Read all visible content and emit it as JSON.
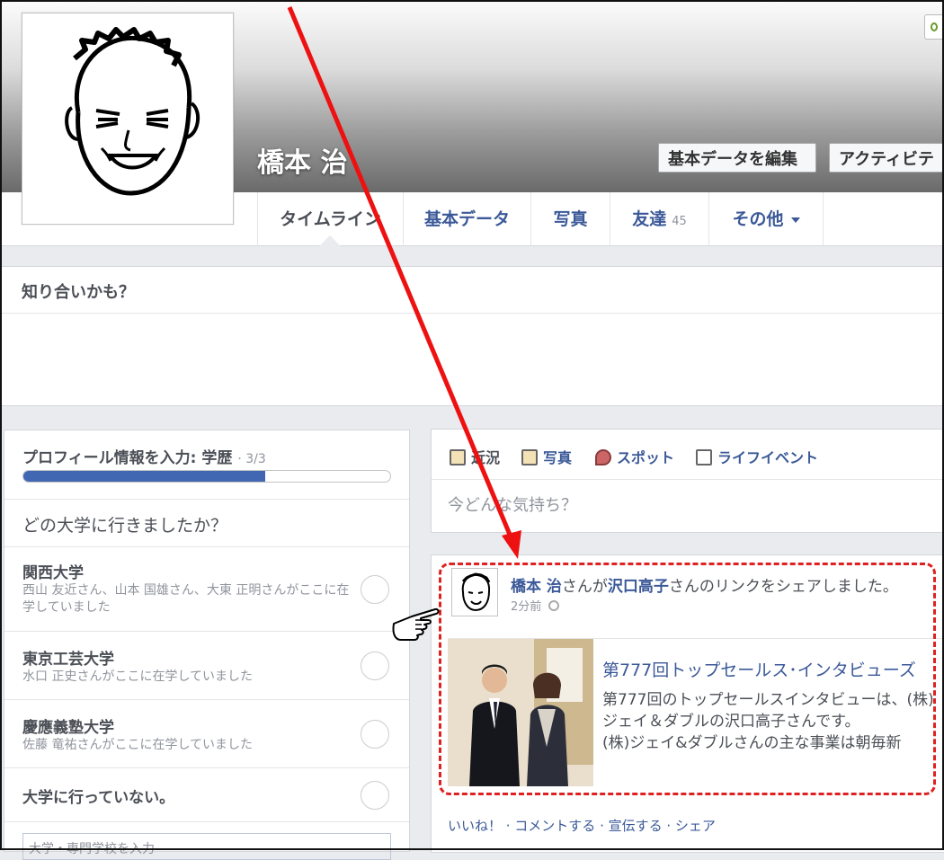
{
  "profile": {
    "name": "橋本 治",
    "edit_button": "基本データを編集",
    "activity_button": "アクティビテ"
  },
  "tabs": [
    {
      "label": "タイムライン",
      "active": true
    },
    {
      "label": "基本データ"
    },
    {
      "label": "写真"
    },
    {
      "label": "友達",
      "count": "45"
    },
    {
      "label": "その他"
    }
  ],
  "pymk": {
    "title": "知り合いかも？"
  },
  "profile_info": {
    "title": "プロフィール情報を入力: 学歴",
    "progress_text": "· 3/3",
    "progress_fraction": 0.66,
    "question": "どの大学に行きましたか？",
    "schools": [
      {
        "name": "関西大学",
        "desc": "西山 友近さん、山本 国雄さん、大東 正明さんがここに在学していました"
      },
      {
        "name": "東京工芸大学",
        "desc": "水口 正史さんがここに在学していました"
      },
      {
        "name": "慶應義塾大学",
        "desc": "佐藤 竜祐さんがここに在学していました"
      },
      {
        "name": "大学に行っていない。",
        "desc": ""
      }
    ],
    "input_placeholder": "大学・専門学校を入力"
  },
  "composer": {
    "actions": [
      "近況",
      "写真",
      "スポット",
      "ライフイベント"
    ],
    "placeholder": "今どんな気持ち？"
  },
  "post": {
    "author": "橋本 治",
    "middle": "さんが",
    "shared_from": "沢口高子",
    "tail": "さんのリンクをシェアしました。",
    "time": "2分前",
    "link_title": "第777回トップセールス･インタビューズ",
    "link_desc": [
      "第777回のトップセールスインタビューは、(株)",
      "ジェイ＆ダブルの沢口高子さんです。",
      "(株)ジェイ&ダブルさんの主な事業は朝毎新"
    ],
    "actions": "いいね！ · コメントする · 宣伝する · シェア"
  },
  "colors": {
    "link": "#3b5998",
    "annotation": "#e02020",
    "progress": "#4267b2"
  },
  "icons": [
    "status-icon",
    "photo-icon",
    "place-pin-icon",
    "life-event-book-icon",
    "globe-icon",
    "pointing-hand-icon",
    "red-arrow-annotation"
  ]
}
